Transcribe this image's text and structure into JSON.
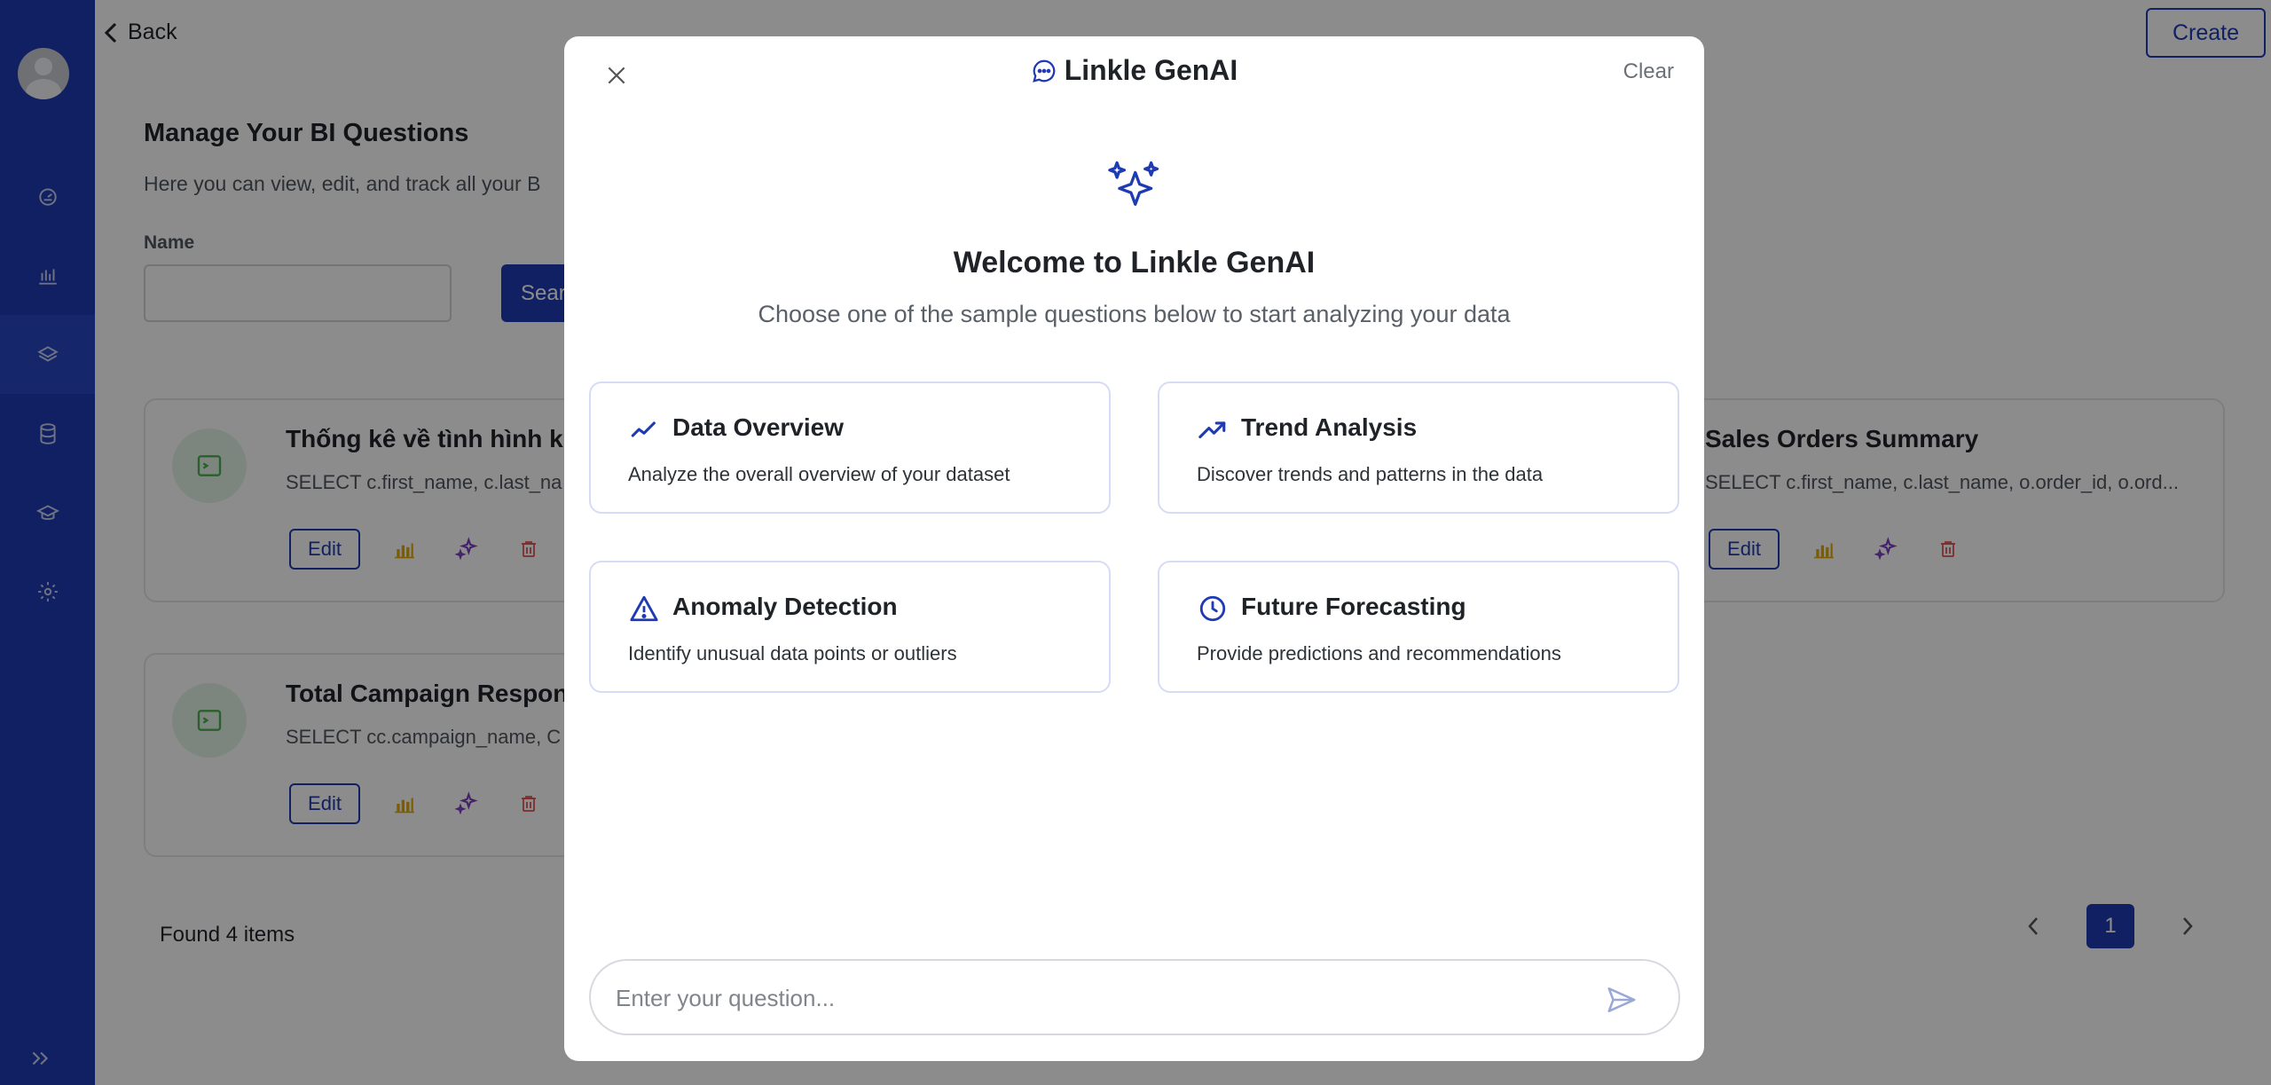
{
  "sidebar": {
    "nav": [
      {
        "name": "dashboard"
      },
      {
        "name": "charts"
      },
      {
        "name": "questions"
      },
      {
        "name": "database"
      },
      {
        "name": "learning"
      },
      {
        "name": "settings"
      }
    ]
  },
  "header": {
    "back_label": "Back",
    "create_label": "Create"
  },
  "page": {
    "title": "Manage Your BI Questions",
    "subtitle": "Here you can view, edit, and track all your B",
    "name_label": "Name",
    "name_value": "",
    "search_label": "Sear"
  },
  "cards": [
    {
      "title": "Thống kê về tình hình kin",
      "sql": "SELECT c.first_name, c.last_na",
      "edit_label": "Edit"
    },
    {
      "title": "Sales Orders Summary",
      "sql": "SELECT c.first_name, c.last_name, o.order_id, o.ord...",
      "edit_label": "Edit"
    },
    {
      "title": "Total Campaign Respons",
      "sql": "SELECT cc.campaign_name, C",
      "edit_label": "Edit"
    }
  ],
  "footer": {
    "found_text": "Found 4 items",
    "current_page": "1"
  },
  "modal": {
    "title": "Linkle GenAI",
    "clear_label": "Clear",
    "welcome_title": "Welcome to Linkle GenAI",
    "welcome_sub": "Choose one of the sample questions below to start analyzing your data",
    "samples": [
      {
        "icon": "line-chart-icon",
        "title": "Data Overview",
        "desc": "Analyze the overall overview of your dataset"
      },
      {
        "icon": "trending-up-icon",
        "title": "Trend Analysis",
        "desc": "Discover trends and patterns in the data"
      },
      {
        "icon": "warning-icon",
        "title": "Anomaly Detection",
        "desc": "Identify unusual data points or outliers"
      },
      {
        "icon": "clock-icon",
        "title": "Future Forecasting",
        "desc": "Provide predictions and recommendations"
      }
    ],
    "question_placeholder": "Enter your question...",
    "question_value": ""
  },
  "colors": {
    "sidebar": "#1f3bb3",
    "accent": "#1f3bb3",
    "overlay": "rgba(0,0,0,0.45)"
  }
}
